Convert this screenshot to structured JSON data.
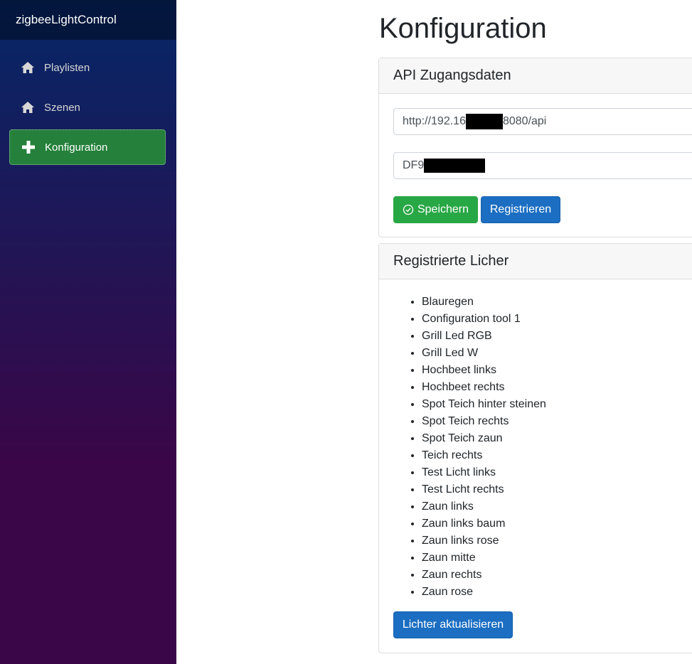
{
  "sidebar": {
    "brand": "zigbeeLightControl",
    "items": [
      {
        "label": "Playlisten",
        "icon": "home-icon",
        "active": false
      },
      {
        "label": "Szenen",
        "icon": "home-icon",
        "active": false
      },
      {
        "label": "Konfiguration",
        "icon": "plus-icon",
        "active": true
      }
    ]
  },
  "page": {
    "title": "Konfiguration"
  },
  "api_card": {
    "header": "API Zugangsdaten",
    "url_prefix": "http://192.16",
    "url_suffix": "8080/api",
    "key_prefix": "DF9",
    "save_label": "Speichern",
    "register_label": "Registrieren"
  },
  "lights_card": {
    "header": "Registrierte Licher",
    "items": [
      "Blauregen",
      "Configuration tool 1",
      "Grill Led RGB",
      "Grill Led W",
      "Hochbeet links",
      "Hochbeet rechts",
      "Spot Teich hinter steinen",
      "Spot Teich rechts",
      "Spot Teich zaun",
      "Teich rechts",
      "Test Licht links",
      "Test Licht rechts",
      "Zaun links",
      "Zaun links baum",
      "Zaun links rose",
      "Zaun mitte",
      "Zaun rechts",
      "Zaun rose"
    ],
    "refresh_label": "Lichter aktualisieren"
  },
  "colors": {
    "sidebar_top": "#052767",
    "sidebar_bottom": "#3a0647",
    "active_nav": "#24803a",
    "success": "#28a745",
    "primary": "#1b6ec2"
  }
}
